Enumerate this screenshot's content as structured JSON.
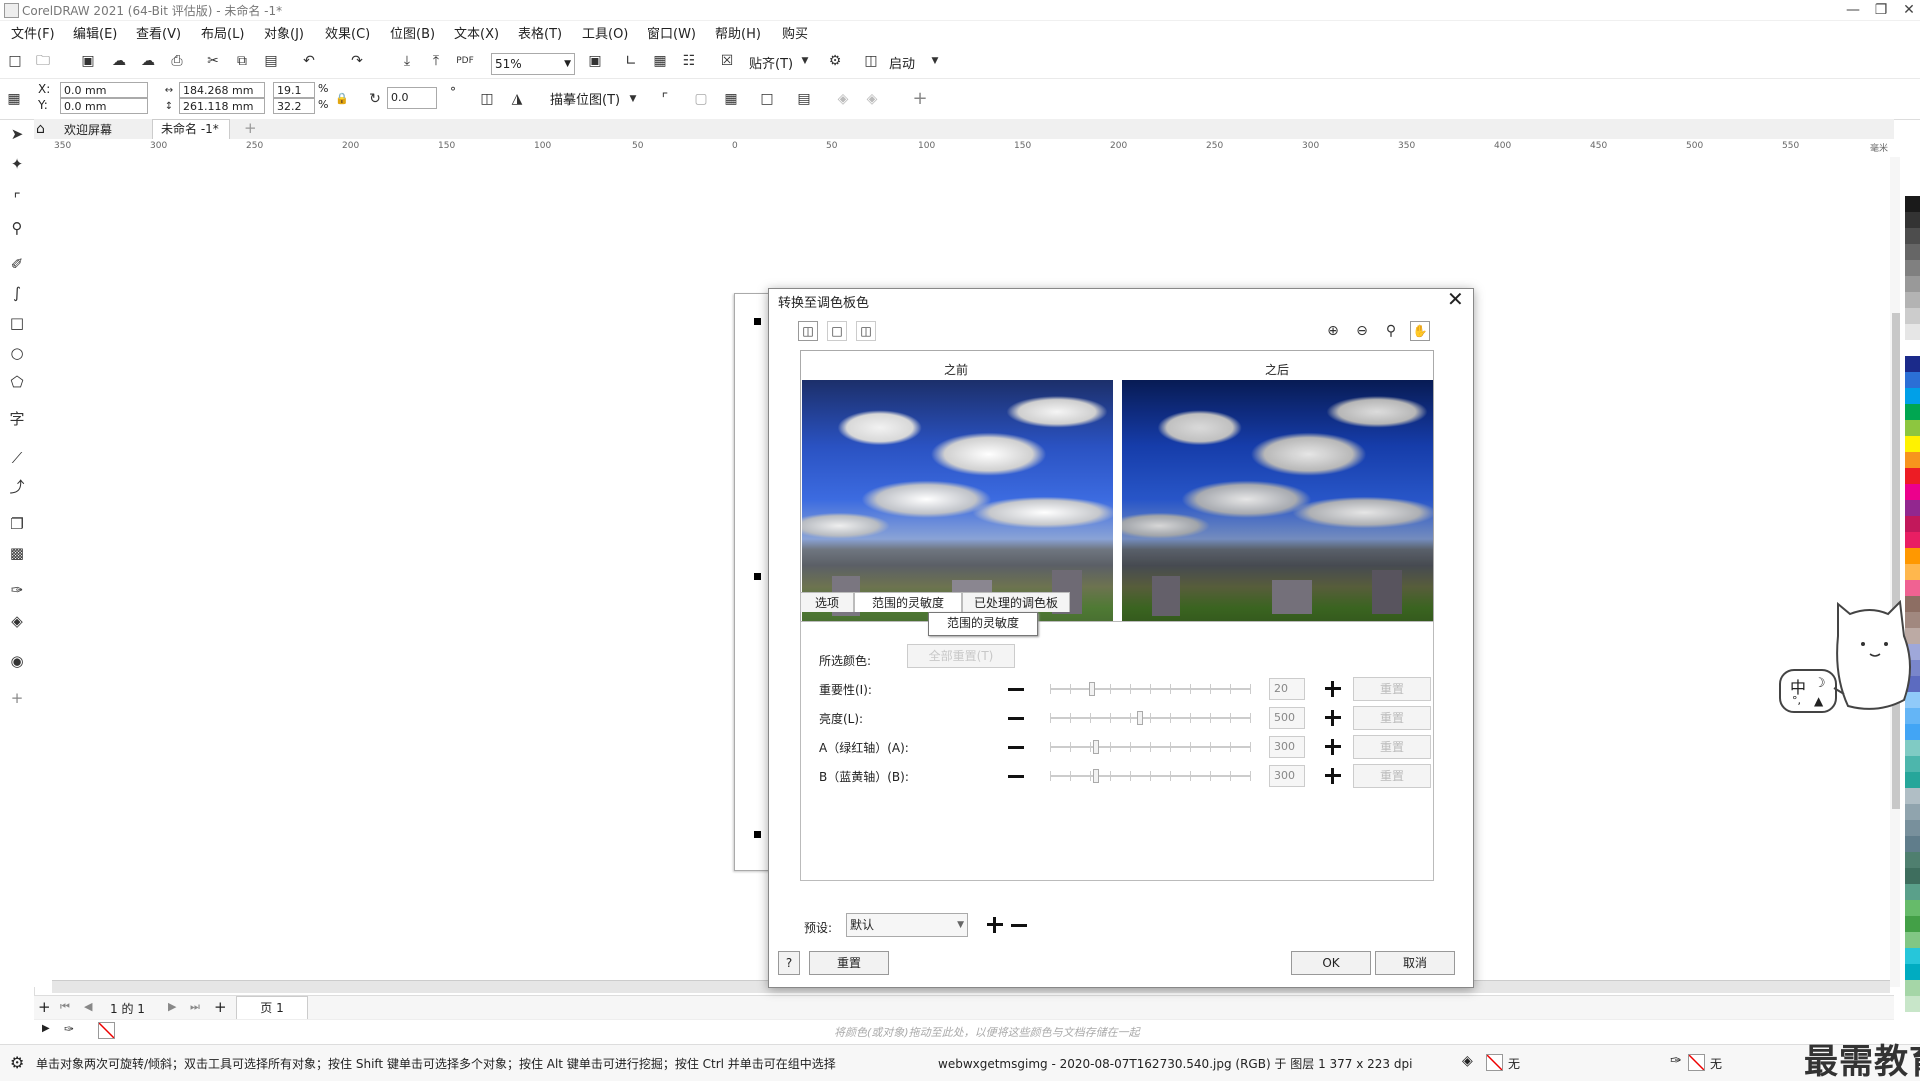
{
  "window": {
    "title": "CorelDRAW 2021 (64-Bit 评估版) - 未命名 -1*"
  },
  "menu": [
    "文件(F)",
    "编辑(E)",
    "查看(V)",
    "布局(L)",
    "对象(J)",
    "效果(C)",
    "位图(B)",
    "文本(X)",
    "表格(T)",
    "工具(O)",
    "窗口(W)",
    "帮助(H)",
    "购买"
  ],
  "toolbar1": {
    "zoom": "51%",
    "snap_label": "贴齐(T)",
    "launch_label": "启动"
  },
  "toolbar2": {
    "x_label": "X:",
    "y_label": "Y:",
    "x": "0.0 mm",
    "y": "0.0 mm",
    "width": "184.268 mm",
    "height": "261.118 mm",
    "scale_w": "19.1",
    "scale_h": "32.2",
    "pct": "%",
    "rotation": "0.0",
    "deg": "°",
    "trace_label": "描摹位图(T)"
  },
  "doc_tabs": {
    "welcome": "欢迎屏幕",
    "doc": "未命名 -1*"
  },
  "ruler_h": [
    "350",
    "300",
    "250",
    "200",
    "150",
    "100",
    "50",
    "0",
    "50",
    "100",
    "150",
    "200",
    "250",
    "300",
    "350",
    "400",
    "450",
    "500",
    "550",
    "毫米"
  ],
  "dialog": {
    "title": "转换至调色板色",
    "before_label": "之前",
    "after_label": "之后",
    "tabs": [
      "选项",
      "范围的灵敏度",
      "已处理的调色板"
    ],
    "tooltip": "范围的灵敏度",
    "selected_color_label": "所选颜色:",
    "reset_all_label": "全部重置(T)",
    "params": [
      {
        "label": "重要性(I):",
        "value": "20",
        "pos": 0.2
      },
      {
        "label": "亮度(L):",
        "value": "500",
        "pos": 0.45
      },
      {
        "label": "A（绿红轴）(A):",
        "value": "300",
        "pos": 0.22
      },
      {
        "label": "B（蓝黄轴）(B):",
        "value": "300",
        "pos": 0.22
      }
    ],
    "param_reset_label": "重置",
    "preset_label": "预设:",
    "preset_value": "默认",
    "help_label": "?",
    "reset_label": "重置",
    "ok_label": "OK",
    "cancel_label": "取消"
  },
  "pagebar": {
    "page_count": "1 的 1",
    "page_tab": "页 1"
  },
  "colorbar_hint": "将颜色(或对象)拖动至此处，以便将这些颜色与文档存储在一起",
  "status": {
    "hint": "单击对象两次可旋转/倾斜；双击工具可选择所有对象；按住 Shift 键单击可选择多个对象；按住 Alt 键单击可进行挖掘；按住 Ctrl 并单击可在组中选择",
    "file_info": "webwxgetmsgimg - 2020-08-07T162730.540.jpg (RGB) 于 图层 1 377 x 223 dpi",
    "fill_none": "无",
    "outline_none": "无"
  },
  "mascot": {
    "text": "中"
  },
  "watermark": "最需教育",
  "palette_colors": [
    "#ffffff",
    "#1a1a1a",
    "#333333",
    "#4d4d4d",
    "#666666",
    "#808080",
    "#999999",
    "#b3b3b3",
    "#cccccc",
    "#e6e6e6",
    "#ffffff",
    "#1b2a8a",
    "#2b6fd6",
    "#00a0e8",
    "#00a651",
    "#8dc63f",
    "#fff200",
    "#f7941d",
    "#ed1c24",
    "#ec008c",
    "#92278f",
    "#c2185b",
    "#e91e63",
    "#ff9800",
    "#ffb74d",
    "#f06292",
    "#8d6e63",
    "#a1887f",
    "#bcaaa4",
    "#9fa8da",
    "#7986cb",
    "#5c6bc0",
    "#90caf9",
    "#64b5f6",
    "#42a5f5",
    "#80cbc4",
    "#4db6ac",
    "#26a69a",
    "#b0bec5",
    "#90a4ae",
    "#78909c",
    "#607d8b",
    "#4f7f6f",
    "#3e6e5e",
    "#5aa08a",
    "#66bb6a",
    "#43a047",
    "#81c784",
    "#26c6da",
    "#00acc1",
    "#a5d6a7",
    "#c8e6c9"
  ]
}
